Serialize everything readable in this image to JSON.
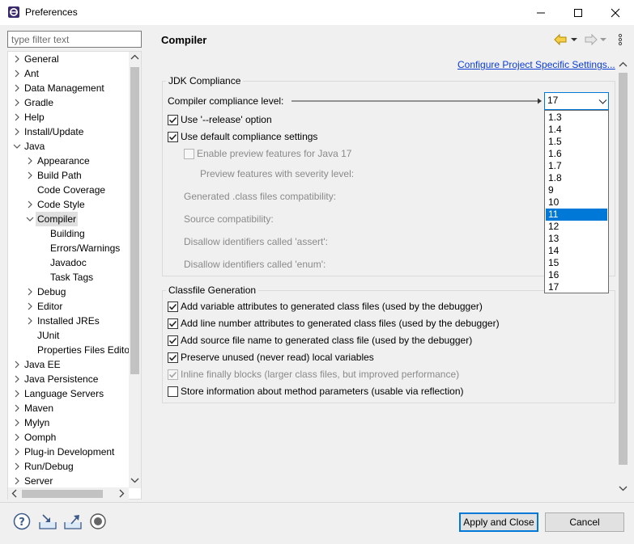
{
  "window": {
    "title": "Preferences"
  },
  "filter": {
    "placeholder": "type filter text"
  },
  "tree": {
    "items": [
      {
        "label": "General",
        "expander": "collapsed"
      },
      {
        "label": "Ant",
        "expander": "collapsed"
      },
      {
        "label": "Data Management",
        "expander": "collapsed"
      },
      {
        "label": "Gradle",
        "expander": "collapsed"
      },
      {
        "label": "Help",
        "expander": "collapsed"
      },
      {
        "label": "Install/Update",
        "expander": "collapsed"
      },
      {
        "label": "Java",
        "expander": "expanded"
      },
      {
        "label": "Appearance",
        "expander": "collapsed"
      },
      {
        "label": "Build Path",
        "expander": "collapsed"
      },
      {
        "label": "Code Coverage",
        "expander": "none"
      },
      {
        "label": "Code Style",
        "expander": "collapsed"
      },
      {
        "label": "Compiler",
        "expander": "expanded",
        "selected": true
      },
      {
        "label": "Building",
        "expander": "none"
      },
      {
        "label": "Errors/Warnings",
        "expander": "none"
      },
      {
        "label": "Javadoc",
        "expander": "none"
      },
      {
        "label": "Task Tags",
        "expander": "none"
      },
      {
        "label": "Debug",
        "expander": "collapsed"
      },
      {
        "label": "Editor",
        "expander": "collapsed"
      },
      {
        "label": "Installed JREs",
        "expander": "collapsed"
      },
      {
        "label": "JUnit",
        "expander": "none"
      },
      {
        "label": "Properties Files Edito",
        "expander": "none"
      },
      {
        "label": "Java EE",
        "expander": "collapsed"
      },
      {
        "label": "Java Persistence",
        "expander": "collapsed"
      },
      {
        "label": "Language Servers",
        "expander": "collapsed"
      },
      {
        "label": "Maven",
        "expander": "collapsed"
      },
      {
        "label": "Mylyn",
        "expander": "collapsed"
      },
      {
        "label": "Oomph",
        "expander": "collapsed"
      },
      {
        "label": "Plug-in Development",
        "expander": "collapsed"
      },
      {
        "label": "Run/Debug",
        "expander": "collapsed"
      },
      {
        "label": "Server",
        "expander": "collapsed"
      }
    ]
  },
  "page": {
    "title": "Compiler",
    "configure_link": "Configure Project Specific Settings...",
    "jdk": {
      "group_title": "JDK Compliance",
      "level_label": "Compiler compliance level:",
      "level_value": "17",
      "use_release": {
        "label": "Use '--release' option",
        "checked": true
      },
      "use_default": {
        "label": "Use default compliance settings",
        "checked": true
      },
      "enable_preview": {
        "label": "Enable preview features for Java 17",
        "checked": false,
        "disabled": true
      },
      "preview_severity": "Preview features with severity level:",
      "generated_compat": "Generated .class files compatibility:",
      "source_compat": "Source compatibility:",
      "disallow_assert": "Disallow identifiers called 'assert':",
      "disallow_enum": "Disallow identifiers called 'enum':"
    },
    "dropdown": {
      "options": [
        "1.3",
        "1.4",
        "1.5",
        "1.6",
        "1.7",
        "1.8",
        "9",
        "10",
        "11",
        "12",
        "13",
        "14",
        "15",
        "16",
        "17"
      ],
      "highlighted": "11"
    },
    "classfile": {
      "group_title": "Classfile Generation",
      "options": [
        {
          "label": "Add variable attributes to generated class files (used by the debugger)",
          "checked": true,
          "disabled": false
        },
        {
          "label": "Add line number attributes to generated class files (used by the debugger)",
          "checked": true,
          "disabled": false
        },
        {
          "label": "Add source file name to generated class file (used by the debugger)",
          "checked": true,
          "disabled": false
        },
        {
          "label": "Preserve unused (never read) local variables",
          "checked": true,
          "disabled": false
        },
        {
          "label": "Inline finally blocks (larger class files, but improved performance)",
          "checked": true,
          "disabled": true
        },
        {
          "label": "Store information about method parameters (usable via reflection)",
          "checked": false,
          "disabled": false
        }
      ]
    }
  },
  "buttons": {
    "apply_close": "Apply and Close",
    "cancel": "Cancel"
  },
  "bottom_icons": [
    "help-icon",
    "import-icon",
    "export-icon",
    "record-icon"
  ],
  "colors": {
    "accent": "#0078d7",
    "link": "#0b3cd6"
  }
}
